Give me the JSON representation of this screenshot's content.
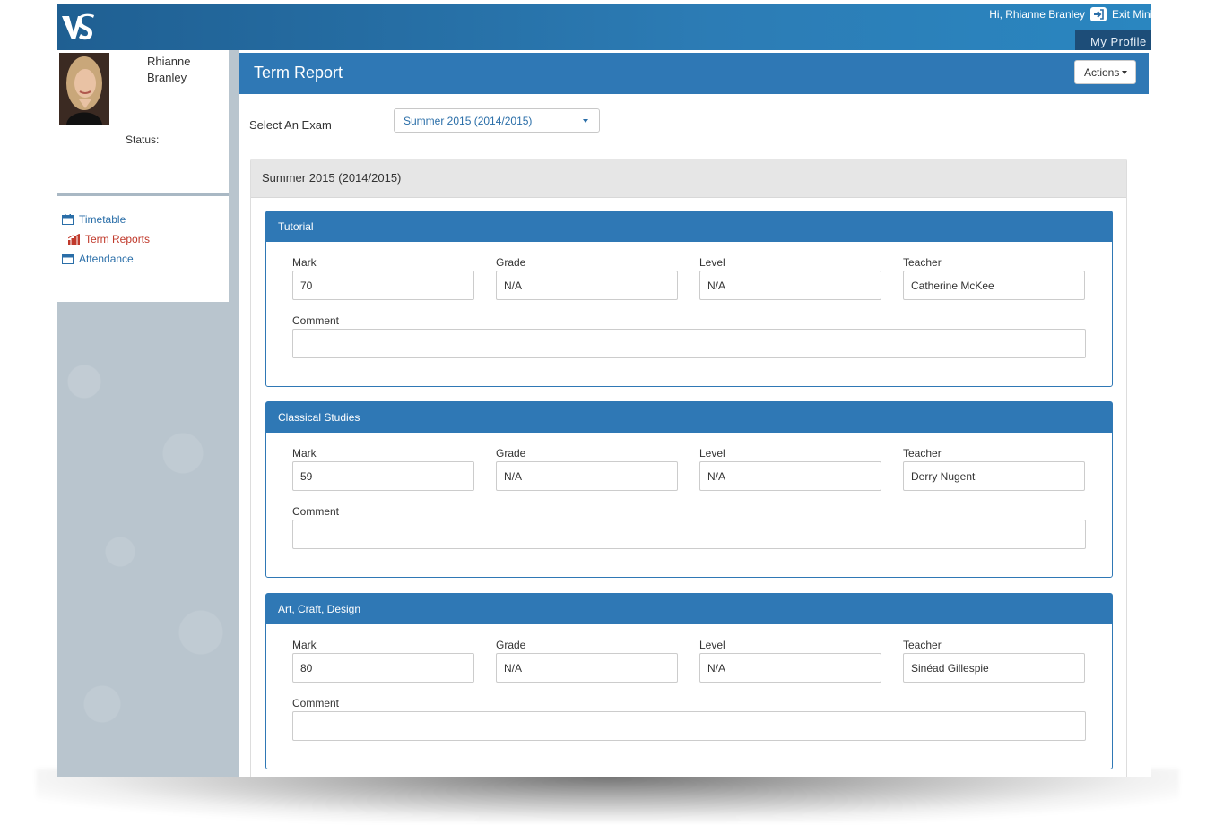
{
  "header": {
    "greeting": "Hi, Rhianne Branley",
    "exit_label": "Exit Mini",
    "my_profile": "My Profile"
  },
  "profile": {
    "name": "Rhianne Branley",
    "status_label": "Status:"
  },
  "nav": {
    "items": [
      {
        "label": "Timetable",
        "icon": "calendar-icon"
      },
      {
        "label": "Term Reports",
        "icon": "bar-chart-icon"
      },
      {
        "label": "Attendance",
        "icon": "calendar-icon"
      }
    ]
  },
  "page": {
    "title": "Term Report",
    "actions_label": "Actions",
    "exam_label": "Select An Exam",
    "exam_selected": "Summer 2015 (2014/2015)",
    "panel_title": "Summer 2015 (2014/2015)"
  },
  "labels": {
    "mark": "Mark",
    "grade": "Grade",
    "level": "Level",
    "teacher": "Teacher",
    "comment": "Comment"
  },
  "subjects": [
    {
      "name": "Tutorial",
      "mark": "70",
      "grade": "N/A",
      "level": "N/A",
      "teacher": "Catherine McKee",
      "comment": ""
    },
    {
      "name": "Classical Studies",
      "mark": "59",
      "grade": "N/A",
      "level": "N/A",
      "teacher": "Derry Nugent",
      "comment": ""
    },
    {
      "name": "Art, Craft, Design",
      "mark": "80",
      "grade": "N/A",
      "level": "N/A",
      "teacher": "Sinéad Gillespie",
      "comment": ""
    }
  ],
  "colors": {
    "brand_blue": "#2f78b5",
    "link_blue": "#2a6ea8",
    "active_red": "#c0392b"
  }
}
